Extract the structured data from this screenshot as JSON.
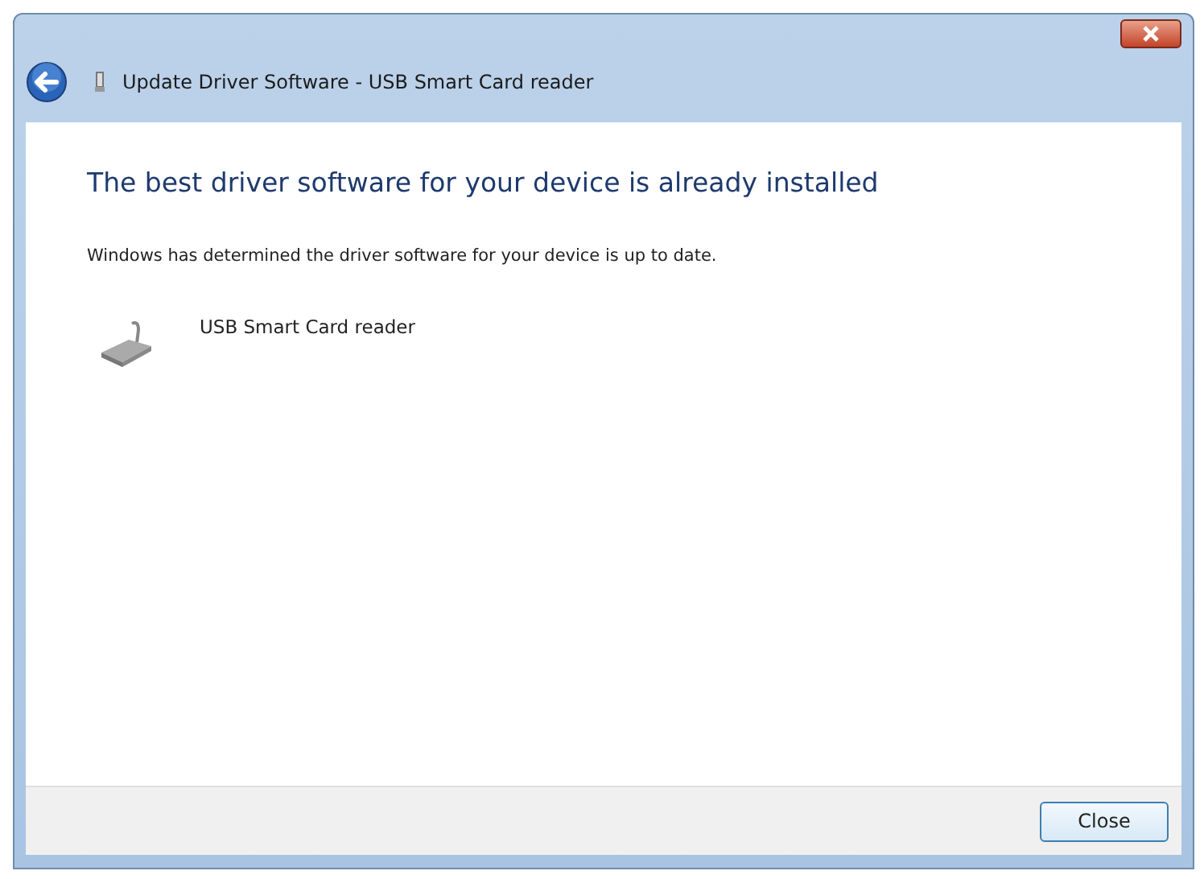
{
  "window": {
    "title": "Update Driver Software - USB Smart Card reader"
  },
  "heading": "The best driver software for your device is already installed",
  "message": "Windows has determined the driver software for your device is up to date.",
  "device": {
    "name": "USB Smart Card reader"
  },
  "buttons": [
    {
      "label": "Close"
    }
  ]
}
